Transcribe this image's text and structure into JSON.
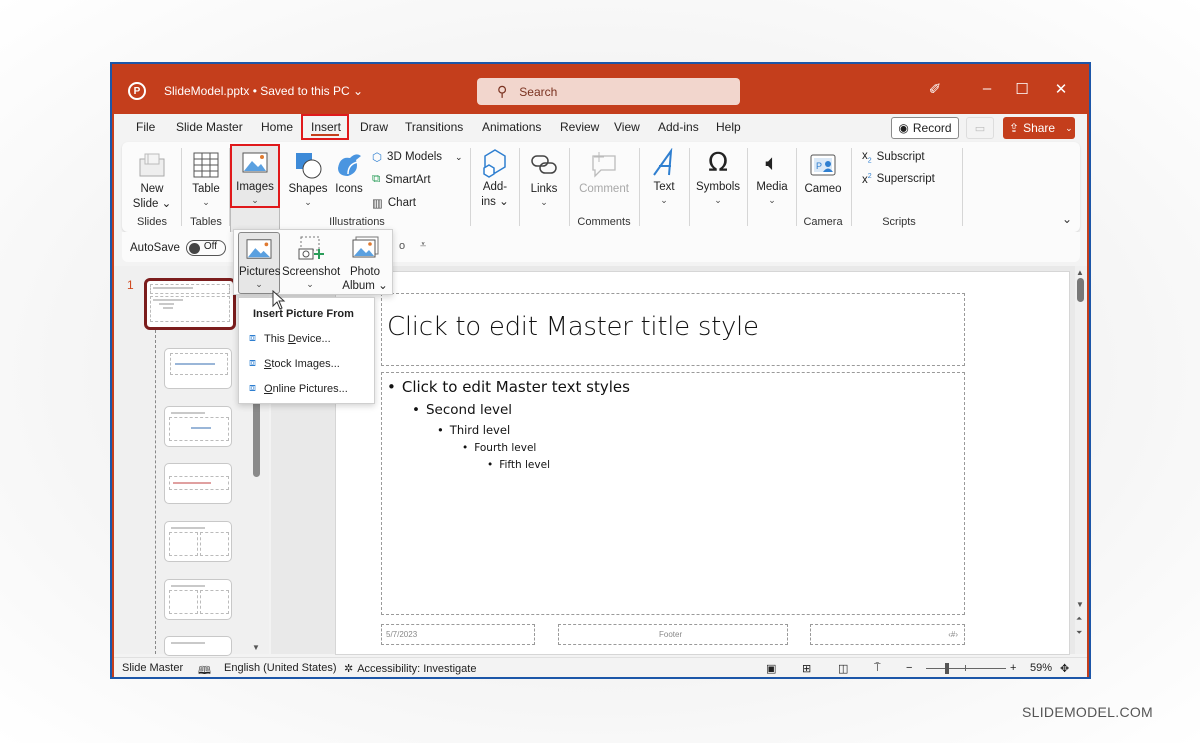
{
  "titlebar": {
    "doc_title": "SlideModel.pptx • Saved to this PC ⌄",
    "search_placeholder": "Search"
  },
  "menu": {
    "tabs": [
      "File",
      "Slide Master",
      "Home",
      "Insert",
      "Draw",
      "Transitions",
      "Animations",
      "Review",
      "View",
      "Add-ins",
      "Help"
    ],
    "active_tab": "Insert",
    "record_label": "Record",
    "share_label": "Share"
  },
  "ribbon": {
    "groups": {
      "slides": "Slides",
      "tables": "Tables",
      "illustrations": "Illustrations",
      "comments": "Comments",
      "camera": "Camera",
      "scripts": "Scripts"
    },
    "buttons": {
      "new_slide_1": "New",
      "new_slide_2": "Slide ⌄",
      "table": "Table",
      "images": "Images",
      "shapes": "Shapes",
      "icons": "Icons",
      "models_3d": "3D Models",
      "smartart": "SmartArt",
      "chart": "Chart",
      "addins_1": "Add-",
      "addins_2": "ins ⌄",
      "links": "Links",
      "comment": "Comment",
      "text": "Text",
      "symbols": "Symbols",
      "media": "Media",
      "cameo": "Cameo",
      "subscript": "Subscript",
      "superscript": "Superscript"
    }
  },
  "qat": {
    "autosave_label": "AutoSave",
    "autosave_state": "Off"
  },
  "images_dropdown": {
    "pictures": "Pictures",
    "screenshot": "Screenshot",
    "photo_album_1": "Photo",
    "photo_album_2": "Album ⌄"
  },
  "picture_menu": {
    "header": "Insert Picture From",
    "items": [
      {
        "pre": "This ",
        "key": "D",
        "post": "evice..."
      },
      {
        "pre": "",
        "key": "S",
        "post": "tock Images..."
      },
      {
        "pre": "",
        "key": "O",
        "post": "nline Pictures..."
      }
    ]
  },
  "slide_pane": {
    "master_number": "1"
  },
  "slide": {
    "title": "Click to edit Master title style",
    "levels": [
      "Click to edit Master text styles",
      "Second level",
      "Third level",
      "Fourth level",
      "Fifth level"
    ],
    "date": "5/7/2023",
    "footer": "Footer",
    "page_number": "‹#›"
  },
  "statusbar": {
    "view_name": "Slide Master",
    "language": "English (United States)",
    "accessibility": "Accessibility: Investigate",
    "zoom_percent": "59%",
    "zoom_level": 0.59
  },
  "watermark": "SLIDEMODEL.COM"
}
